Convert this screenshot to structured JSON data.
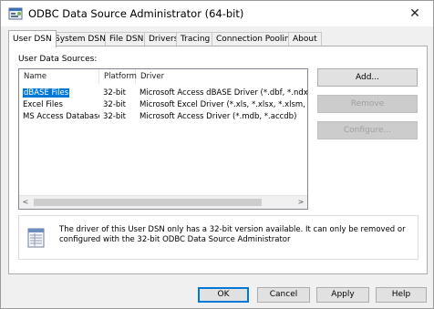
{
  "window": {
    "title": "ODBC Data Source Administrator (64-bit)"
  },
  "tabs": [
    {
      "label": "User DSN"
    },
    {
      "label": "System DSN"
    },
    {
      "label": "File DSN"
    },
    {
      "label": "Drivers"
    },
    {
      "label": "Tracing"
    },
    {
      "label": "Connection Pooling"
    },
    {
      "label": "About"
    }
  ],
  "active_tab": "User DSN",
  "user_dsn": {
    "group_label": "User Data Sources:",
    "columns": [
      "Name",
      "Platform",
      "Driver"
    ],
    "rows": [
      {
        "name": "dBASE Files",
        "platform": "32-bit",
        "driver": "Microsoft Access dBASE Driver (*.dbf, *.ndx, *.m",
        "selected": true
      },
      {
        "name": "Excel Files",
        "platform": "32-bit",
        "driver": "Microsoft Excel Driver (*.xls, *.xlsx, *.xlsm, *.xlsb)",
        "selected": false
      },
      {
        "name": "MS Access Database",
        "platform": "32-bit",
        "driver": "Microsoft Access Driver (*.mdb, *.accdb)",
        "selected": false
      }
    ],
    "buttons": {
      "add": "Add...",
      "remove": "Remove",
      "configure": "Configure..."
    },
    "info_text": "The driver of this User DSN only has a 32-bit version available. It can only be removed or configured with the 32-bit ODBC Data Source Administrator"
  },
  "footer": {
    "ok": "OK",
    "cancel": "Cancel",
    "apply": "Apply",
    "help": "Help"
  },
  "colors": {
    "selection": "#0078d7",
    "focus_border": "#0078d7"
  }
}
